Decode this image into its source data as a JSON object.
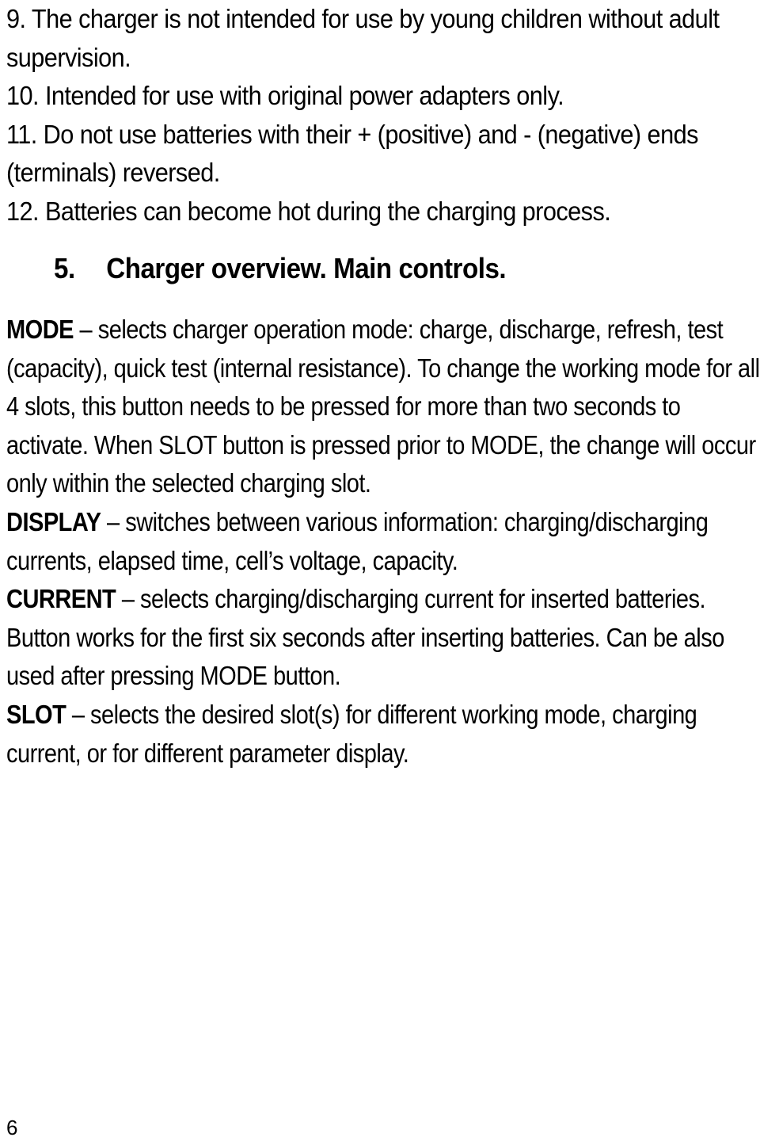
{
  "safety_items": [
    {
      "text": "9. The charger is not intended for use by young children without adult supervision."
    },
    {
      "text": "10. Intended for use with original power adapters only."
    },
    {
      "text": "11. Do not use batteries with their + (positive) and - (negative) ends (terminals) reversed."
    },
    {
      "text": "12. Batteries can become hot during the charging process."
    }
  ],
  "section": {
    "number": "5.",
    "title": "Charger overview. Main controls."
  },
  "controls": [
    {
      "term": "MODE",
      "dash": " – ",
      "description": "selects charger operation mode: charge, discharge, refresh, test (capacity), quick test (internal resistance). To change the working mode for all 4 slots, this button needs to be pressed for more than two seconds to activate. When SLOT button is pressed prior to MODE, the change will occur only within the selected charging slot."
    },
    {
      "term": "DISPLAY",
      "dash": " – ",
      "description": "switches between various information: charging/discharging currents, elapsed time, cell’s voltage, capacity."
    },
    {
      "term": "CURRENT",
      "dash": " – ",
      "description": "selects charging/discharging current for inserted batteries. Button works for the first six seconds after inserting batteries. Can be also used after pressing MODE button."
    },
    {
      "term": "SLOT",
      "dash": " – ",
      "description": "selects the desired slot(s) for different working mode, charging current, or for different parameter display."
    }
  ],
  "footer": {
    "page_number": "6"
  }
}
